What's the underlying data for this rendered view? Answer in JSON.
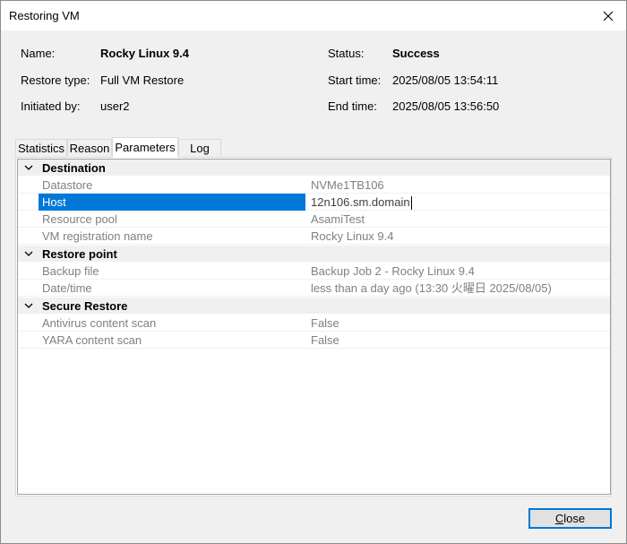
{
  "window": {
    "title": "Restoring VM"
  },
  "summary": {
    "name_label": "Name:",
    "name_value": "Rocky Linux 9.4",
    "restore_type_label": "Restore type:",
    "restore_type_value": "Full VM Restore",
    "initiated_by_label": "Initiated by:",
    "initiated_by_value": "user2",
    "status_label": "Status:",
    "status_value": "Success",
    "start_time_label": "Start time:",
    "start_time_value": "2025/08/05 13:54:11",
    "end_time_label": "End time:",
    "end_time_value": "2025/08/05 13:56:50"
  },
  "tabs": [
    {
      "label": "Statistics",
      "active": false
    },
    {
      "label": "Reason",
      "active": false
    },
    {
      "label": "Parameters",
      "active": true
    },
    {
      "label": "Log",
      "active": false
    }
  ],
  "parameters": {
    "groups": [
      {
        "title": "Destination",
        "rows": [
          {
            "name": "Datastore",
            "value": "NVMe1TB106"
          },
          {
            "name": "Host",
            "value": "12n106.sm.domain",
            "selected": true
          },
          {
            "name": "Resource pool",
            "value": "AsamiTest"
          },
          {
            "name": "VM registration name",
            "value": "Rocky Linux 9.4"
          }
        ]
      },
      {
        "title": "Restore point",
        "rows": [
          {
            "name": "Backup file",
            "value": "Backup Job 2 - Rocky Linux 9.4"
          },
          {
            "name": "Date/time",
            "value": "less than a day ago (13:30 火曜日 2025/08/05)"
          }
        ]
      },
      {
        "title": "Secure Restore",
        "rows": [
          {
            "name": "Antivirus content scan",
            "value": "False"
          },
          {
            "name": "YARA content scan",
            "value": "False"
          }
        ]
      }
    ]
  },
  "buttons": {
    "close_prefix": "C",
    "close_rest": "lose"
  },
  "icons": {
    "close": "close-icon",
    "collapse": "chevron-down-icon"
  }
}
